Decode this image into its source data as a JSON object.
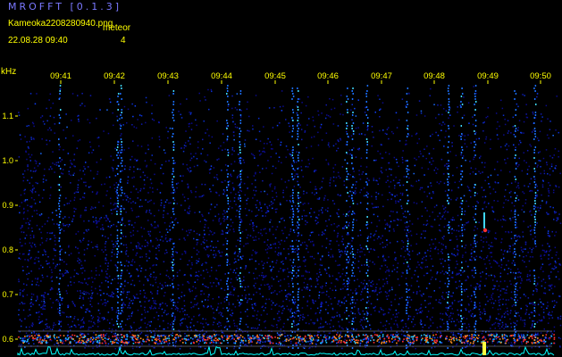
{
  "app": {
    "title": "MROFFT [0.1.3]"
  },
  "header": {
    "filename": "Kameoka2208280940.png",
    "datetime": "22.08.28 09:40",
    "meteor_label": "meteor",
    "meteor_count": "4"
  },
  "axis": {
    "unit": "kHz",
    "y_labels": [
      "1.1",
      "1.0",
      "0.9",
      "0.8",
      "0.7",
      "0.6"
    ],
    "time_labels": [
      "09:41",
      "09:42",
      "09:43",
      "09:44",
      "09:45",
      "09:46",
      "09:47",
      "09:48",
      "09:49",
      "09:50"
    ]
  },
  "colors": {
    "background": "#000000",
    "text": "#ffff00",
    "title": "#7a78ff",
    "noise_base": "#0a0a7a",
    "signal_hot": "#ff3030",
    "baseline": "#00ffff"
  }
}
